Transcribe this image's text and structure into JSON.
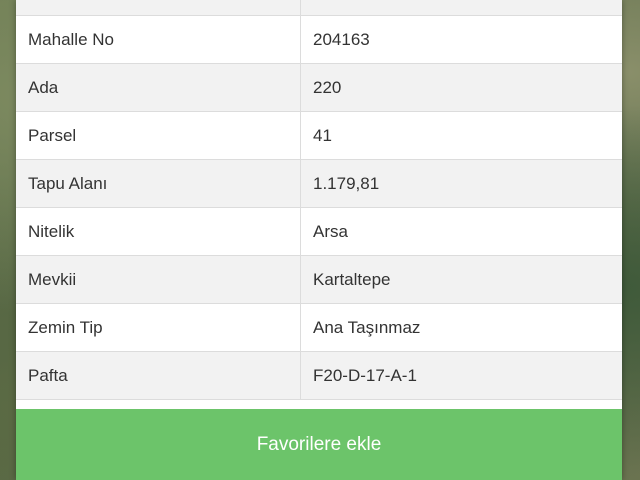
{
  "parcel_info": {
    "rows": [
      {
        "label": "",
        "value": ""
      },
      {
        "label": "Mahalle No",
        "value": "204163"
      },
      {
        "label": "Ada",
        "value": "220"
      },
      {
        "label": "Parsel",
        "value": "41"
      },
      {
        "label": "Tapu Alanı",
        "value": "1.179,81"
      },
      {
        "label": "Nitelik",
        "value": "Arsa"
      },
      {
        "label": "Mevkii",
        "value": "Kartaltepe"
      },
      {
        "label": "Zemin Tip",
        "value": "Ana Taşınmaz"
      },
      {
        "label": "Pafta",
        "value": "F20-D-17-A-1"
      }
    ]
  },
  "actions": {
    "add_favorite_label": "Favorilere ekle"
  },
  "colors": {
    "button_bg": "#6cc46a",
    "row_alt_bg": "#f2f2f2",
    "border": "#dcdcdc",
    "text": "#333333"
  }
}
